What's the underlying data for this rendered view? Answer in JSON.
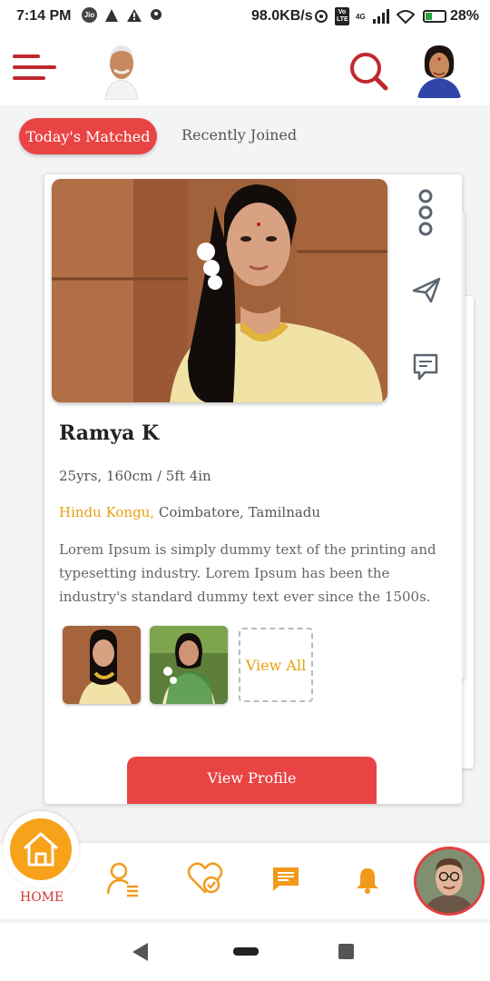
{
  "status_bar": {
    "time": "7:14 PM",
    "left_icons": [
      "jio-icon",
      "triangle-icon",
      "alert-icon",
      "location-icon"
    ],
    "jio_label": "Jio",
    "speed": "98.0KB/s",
    "volte_label": "Vo LTE",
    "network_label": "4G",
    "battery": "28%"
  },
  "header": {
    "menu_icon": "menu-icon",
    "search_icon": "search-icon"
  },
  "tabs": {
    "active": "Today's Matched",
    "inactive": "Recently Joined"
  },
  "profile": {
    "name": "Ramya K",
    "stats": "25yrs, 160cm / 5ft 4in",
    "caste": "Hindu Kongu,",
    "location": " Coimbatore, Tamilnadu",
    "description": "Lorem Ipsum is simply dummy text of the printing and typesetting industry. Lorem Ipsum has been the industry's standard dummy text ever since the 1500s.",
    "view_all": "View All",
    "view_profile": "View Profile"
  },
  "card_actions": [
    "more-options-icon",
    "send-interest-icon",
    "chat-icon"
  ],
  "bottom_nav": {
    "home_label": "HOME",
    "items": [
      "profile-list-icon",
      "heart-check-icon",
      "message-icon",
      "bell-icon"
    ]
  },
  "colors": {
    "accent_red": "#e84444",
    "brand_red": "#c0282e",
    "orange": "#f7a21b",
    "caste_gold": "#e8a012"
  }
}
